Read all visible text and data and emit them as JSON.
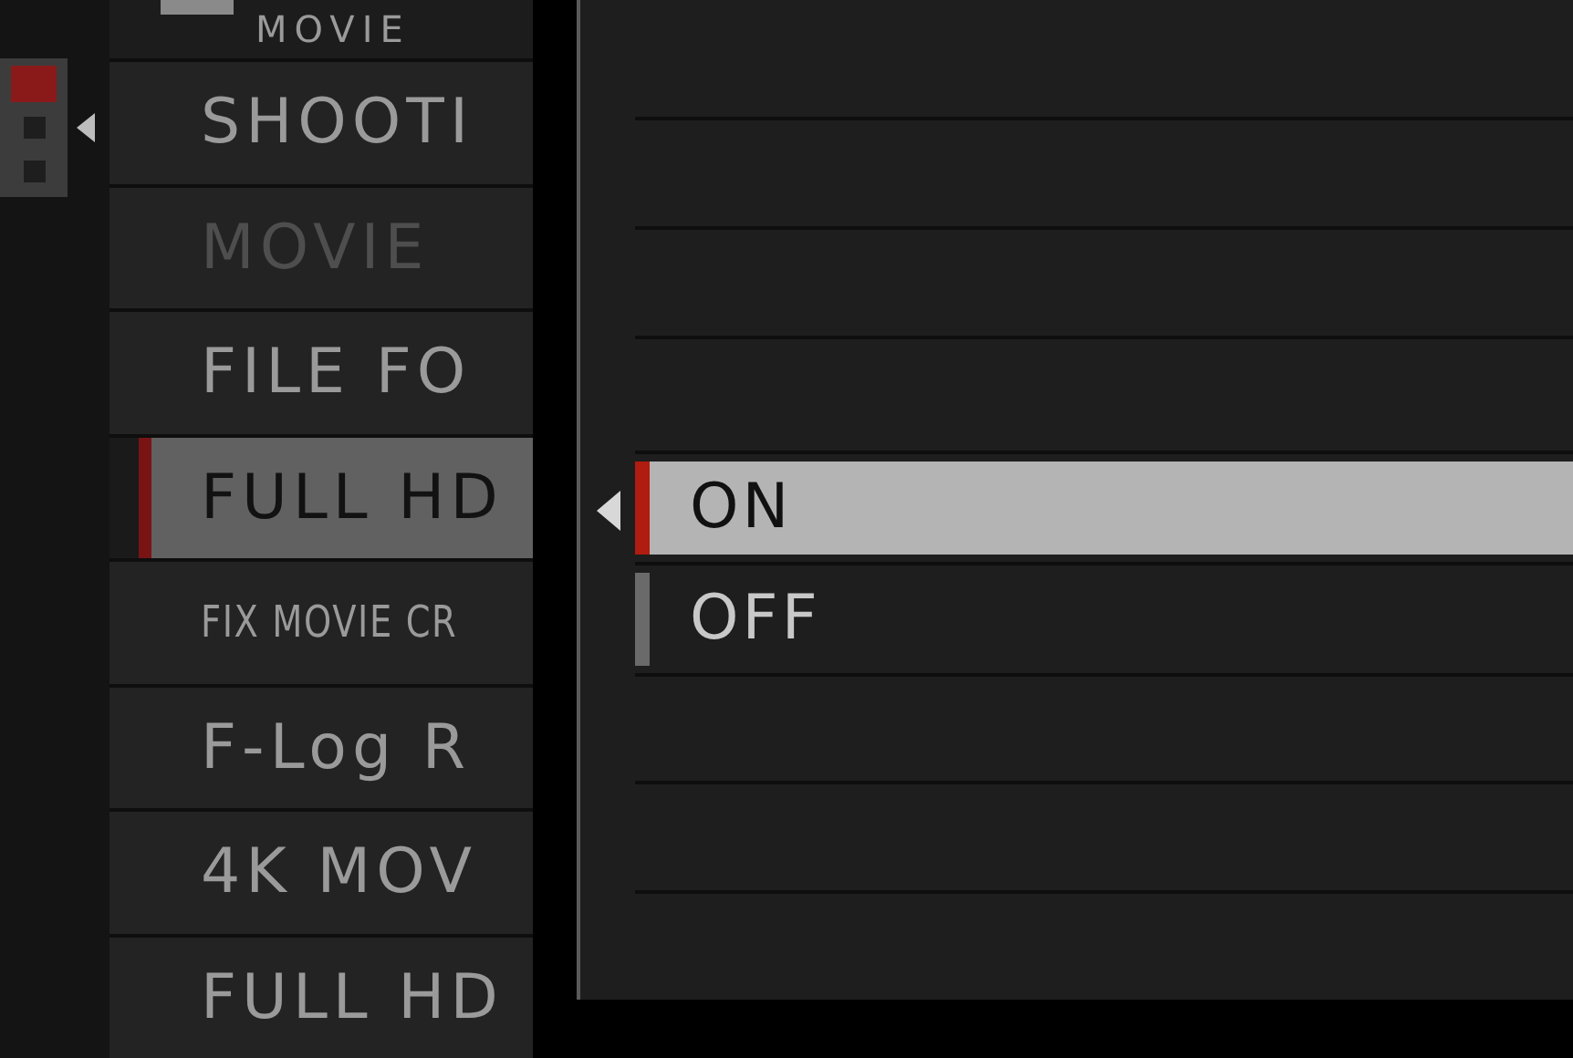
{
  "header": {
    "title": "MOVIE"
  },
  "pages": [
    {
      "selected": true
    },
    {
      "selected": false
    },
    {
      "selected": false
    }
  ],
  "menu": [
    {
      "label": "SHOOTI",
      "kind": "normal",
      "disabled": false,
      "selected": false
    },
    {
      "label": "MOVIE",
      "kind": "normal",
      "disabled": true,
      "selected": false
    },
    {
      "label": "FILE FO",
      "kind": "normal",
      "disabled": false,
      "selected": false
    },
    {
      "label": "FULL HD",
      "kind": "normal",
      "disabled": false,
      "selected": true
    },
    {
      "label": "FIX MOVIE CR",
      "kind": "condensed",
      "disabled": false,
      "selected": false
    },
    {
      "label": "F-Log R",
      "kind": "normal",
      "disabled": false,
      "selected": false
    },
    {
      "label": "4K MOV",
      "kind": "normal",
      "disabled": false,
      "selected": false
    },
    {
      "label": "FULL HD",
      "kind": "normal",
      "disabled": false,
      "selected": false
    }
  ],
  "options": [
    {
      "label": "ON",
      "selected": true
    },
    {
      "label": "OFF",
      "selected": false
    }
  ]
}
